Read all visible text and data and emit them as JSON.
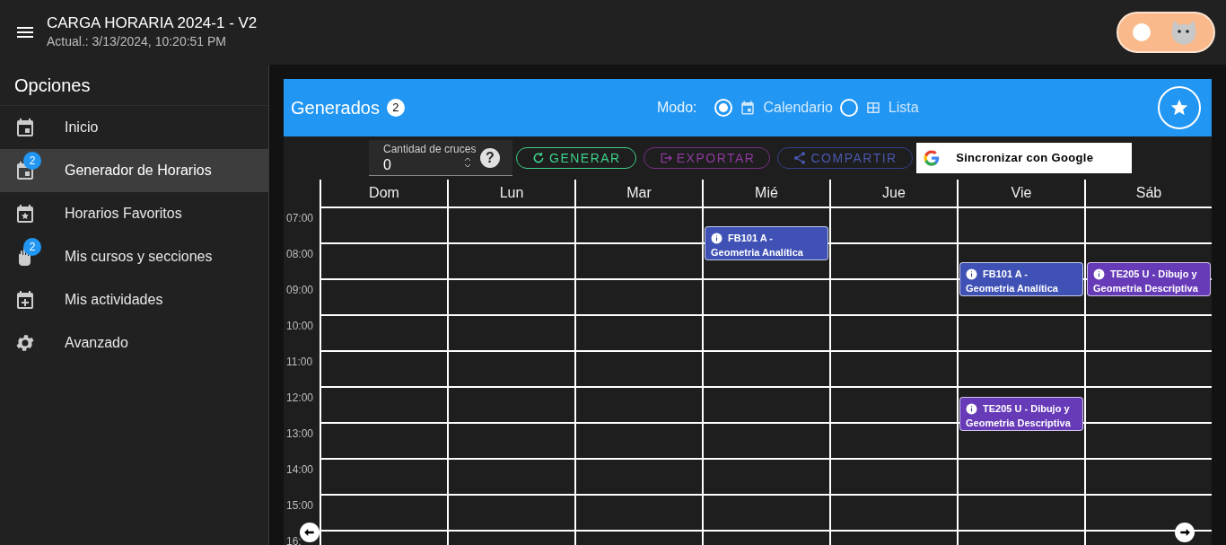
{
  "app_bar": {
    "title": "CARGA HORARIA 2024-1 - V2",
    "subtitle": "Actual.: 3/13/2024, 10:20:51 PM",
    "theme_toggle": {
      "on": false
    }
  },
  "sidebar": {
    "title": "Opciones",
    "items": [
      {
        "label": "Inicio",
        "selected": false
      },
      {
        "label": "Generador de Horarios",
        "badge": "2",
        "selected": true
      },
      {
        "label": "Horarios Favoritos",
        "selected": false
      },
      {
        "label": "Mis cursos y secciones",
        "badge": "2",
        "selected": false
      },
      {
        "label": "Mis actividades",
        "selected": false
      },
      {
        "label": "Avanzado",
        "selected": false
      }
    ]
  },
  "panel": {
    "title": "Generados",
    "count": "2",
    "mode_label": "Modo:",
    "modes": [
      {
        "label": "Calendario",
        "selected": true
      },
      {
        "label": "Lista",
        "selected": false
      }
    ]
  },
  "toolbar": {
    "crossings": {
      "label": "Cantidad de cruces",
      "value": "0",
      "help": "?"
    },
    "buttons": [
      {
        "label": "GENERAR",
        "kind": "generate",
        "disabled": false
      },
      {
        "label": "EXPORTAR",
        "kind": "export",
        "disabled": true
      },
      {
        "label": "COMPARTIR",
        "kind": "share",
        "disabled": true
      }
    ],
    "google_button": "Sincronizar con Google"
  },
  "calendar": {
    "times": [
      "07:00",
      "08:00",
      "09:00",
      "10:00",
      "11:00",
      "12:00",
      "13:00",
      "14:00",
      "15:00",
      "16:"
    ],
    "days": [
      {
        "label": "Dom"
      },
      {
        "label": "Lun"
      },
      {
        "label": "Mar"
      },
      {
        "label": "Mié",
        "events": [
          {
            "code": "FB101 A -",
            "name": "Geometria Analítica",
            "color": "#3f51b5"
          }
        ]
      },
      {
        "label": "Jue"
      },
      {
        "label": "Vie",
        "events": [
          {
            "code": "FB101 A -",
            "name": "Geometria Analítica",
            "color": "#3f51b5"
          },
          {
            "code": "TE205 U - Dibujo y",
            "name": "Geometria Descriptiva",
            "color": "#673ab7"
          }
        ]
      },
      {
        "label": "Sáb",
        "events": [
          {
            "code": "TE205 U - Dibujo y",
            "name": "Geometria Descriptiva",
            "color": "#673ab7"
          }
        ]
      }
    ]
  }
}
